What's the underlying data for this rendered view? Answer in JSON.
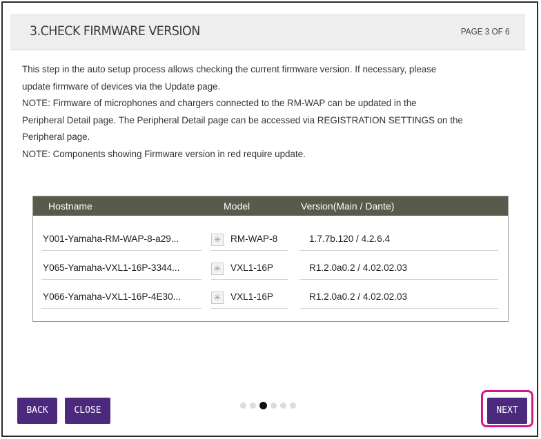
{
  "header": {
    "title": "3.CHECK FIRMWARE VERSION",
    "page": "PAGE 3 OF 6"
  },
  "description": [
    "This step in the auto setup process allows checking the current firmware version. If necessary, please",
    "update firmware of devices via the Update page.",
    "NOTE: Firmware of microphones and chargers connected to the RM-WAP can be updated in the",
    "Peripheral Detail page. The Peripheral Detail page can be accessed via REGISTRATION SETTINGS on the",
    "Peripheral page.",
    "NOTE: Components showing Firmware version in red require update."
  ],
  "table": {
    "columns": [
      "Hostname",
      "Model",
      "Version(Main / Dante)"
    ],
    "rows": [
      {
        "hostname": "Y001-Yamaha-RM-WAP-8-a29...",
        "model": "RM-WAP-8",
        "version": "1.7.7b.120 / 4.2.6.4"
      },
      {
        "hostname": "Y065-Yamaha-VXL1-16P-3344...",
        "model": "VXL1-16P",
        "version": "R1.2.0a0.2 / 4.02.02.03"
      },
      {
        "hostname": "Y066-Yamaha-VXL1-16P-4E30...",
        "model": "VXL1-16P",
        "version": "R1.2.0a0.2 / 4.02.02.03"
      }
    ]
  },
  "buttons": {
    "back": "BACK",
    "close": "CLOSE",
    "next": "NEXT"
  },
  "pagination": {
    "total": 6,
    "current": 3
  },
  "colors": {
    "button": "#4b2a7e",
    "table_header": "#5a5a4c",
    "highlight": "#d01a8a"
  },
  "icons": {
    "device": "device-status-icon"
  }
}
